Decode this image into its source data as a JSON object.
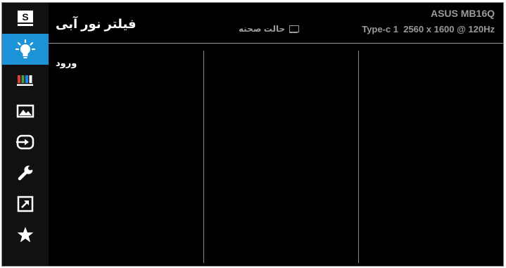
{
  "header": {
    "title": "فیلتر نور آبی",
    "mode_label": "حالت صحنه",
    "mode_icon": "monitor-icon",
    "model": "ASUS MB16Q",
    "signal": "Type-c 1  2560 x 1600 @ 120Hz"
  },
  "sidebar": {
    "active_color": "#1d93d8",
    "items": [
      {
        "icon": "splendid-s-icon"
      },
      {
        "icon": "blue-light-bulb-icon",
        "active": true
      },
      {
        "icon": "color-bars-icon"
      },
      {
        "icon": "image-icon"
      },
      {
        "icon": "input-select-icon"
      },
      {
        "icon": "wrench-icon"
      },
      {
        "icon": "shortcut-arrow-icon"
      },
      {
        "icon": "star-icon"
      }
    ]
  },
  "content": {
    "column1_items": [
      "ورود"
    ]
  }
}
